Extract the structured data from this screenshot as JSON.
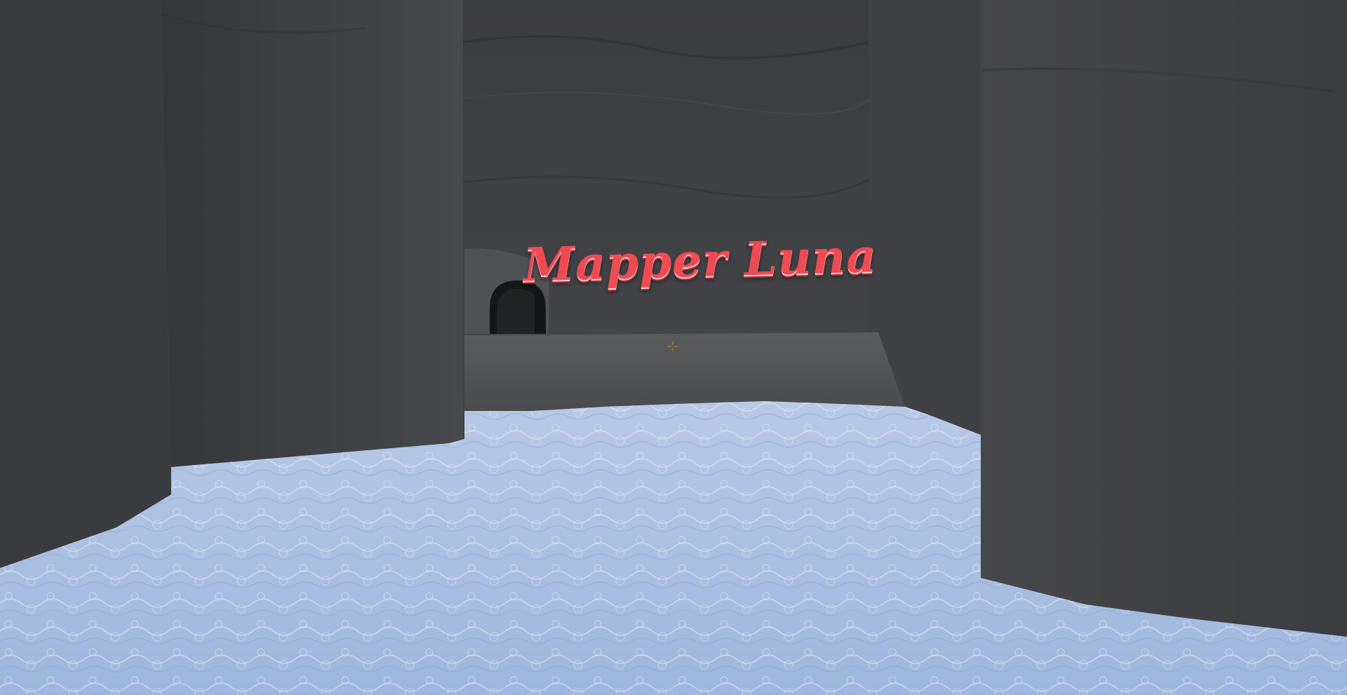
{
  "scene": {
    "sign_text": "Mapper Luna",
    "sign_color": "#ee4b52",
    "wall_color": "#3d3e42",
    "water_color": "#a9bde0",
    "crosshair": "crosshair-icon"
  }
}
